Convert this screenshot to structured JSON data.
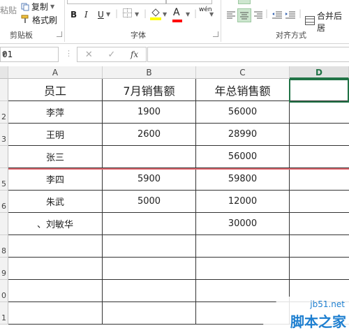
{
  "ribbon": {
    "clipboard": {
      "paste_label": "粘贴",
      "copy_label": "复制",
      "format_painter_label": "格式刷",
      "group_label": "剪贴板"
    },
    "font": {
      "bold": "B",
      "italic": "I",
      "underline": "U",
      "font_color_glyph": "A",
      "pinyin_glyph": "wén",
      "group_label": "字体",
      "highlight_color": "#ffff00",
      "font_color": "#ff0000"
    },
    "alignment": {
      "merge_label": "合并后居",
      "group_label": "对齐方式"
    }
  },
  "formula_bar": {
    "name_box_value": "01",
    "fx_label": "fx",
    "formula_value": ""
  },
  "columns": [
    "A",
    "B",
    "C",
    "D"
  ],
  "row_numbers": [
    "",
    "2",
    "3",
    "",
    "5",
    "6",
    "",
    "8",
    "9",
    "0",
    "1"
  ],
  "table": {
    "headers": [
      "员工",
      "7月销售额",
      "年总销售额"
    ],
    "rows": [
      [
        "李萍",
        "1900",
        "56000"
      ],
      [
        "王明",
        "2600",
        "28990"
      ],
      [
        "张三",
        "",
        "56000"
      ],
      [
        "李四",
        "5900",
        "59800"
      ],
      [
        "朱武",
        "5000",
        "12000"
      ],
      [
        "、刘敏华",
        "",
        "30000"
      ],
      [
        "",
        "",
        ""
      ],
      [
        "",
        "",
        ""
      ],
      [
        "",
        "",
        ""
      ],
      [
        "",
        "",
        ""
      ]
    ]
  },
  "watermark": {
    "site": "jb51.net",
    "brand": "脚本之家"
  },
  "colors": {
    "accent_green": "#217346",
    "red_line": "#e0666d"
  }
}
